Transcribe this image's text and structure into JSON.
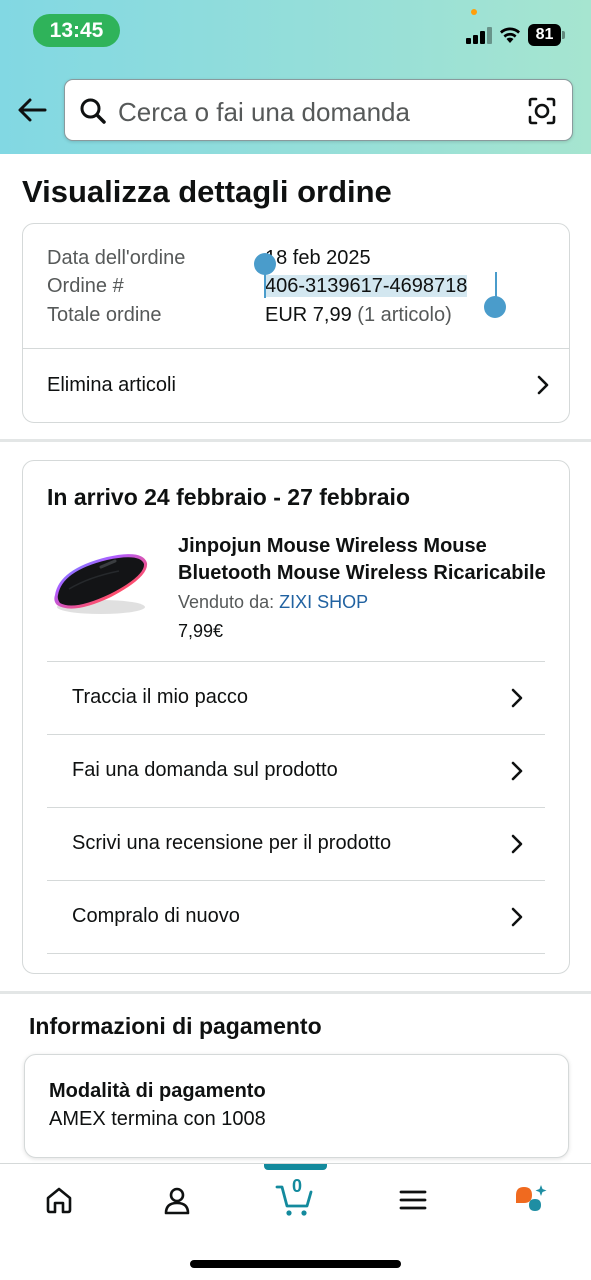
{
  "status_bar": {
    "time": "13:45",
    "battery": "81"
  },
  "search": {
    "placeholder": "Cerca o fai una domanda"
  },
  "page_title": "Visualizza dettagli ordine",
  "order_summary": {
    "date_label": "Data dell'ordine",
    "date_value": "18 feb 2025",
    "order_label": "Ordine #",
    "order_value": "406-3139617-4698718",
    "total_label": "Totale ordine",
    "total_value": "EUR 7,99",
    "total_items": "(1 articolo)",
    "delete_items": "Elimina articoli"
  },
  "shipment": {
    "title": "In arrivo 24 febbraio - 27 febbraio",
    "product_name_line1": "Jinpojun Mouse Wireless Mouse",
    "product_name_line2": "Bluetooth Mouse Wireless Ricaricabile",
    "seller_label": "Venduto da:",
    "seller_name": "ZIXI SHOP",
    "price": "7,99€",
    "actions": [
      "Traccia il mio pacco",
      "Fai una domanda sul prodotto",
      "Scrivi una recensione per il prodotto",
      "Compralo di nuovo"
    ]
  },
  "payment": {
    "section_title": "Informazioni di pagamento",
    "method_label": "Modalità di pagamento",
    "method_value": "AMEX termina con 1008"
  },
  "tabbar": {
    "items": [
      "home-icon",
      "account-icon",
      "cart-icon",
      "menu-icon",
      "rufus-icon"
    ],
    "cart_count": "0",
    "active": "cart-icon"
  },
  "colors": {
    "accent": "#138a9d",
    "link": "#2162a1",
    "selection": "#d3e7f0",
    "handle": "#4a9ccb"
  }
}
